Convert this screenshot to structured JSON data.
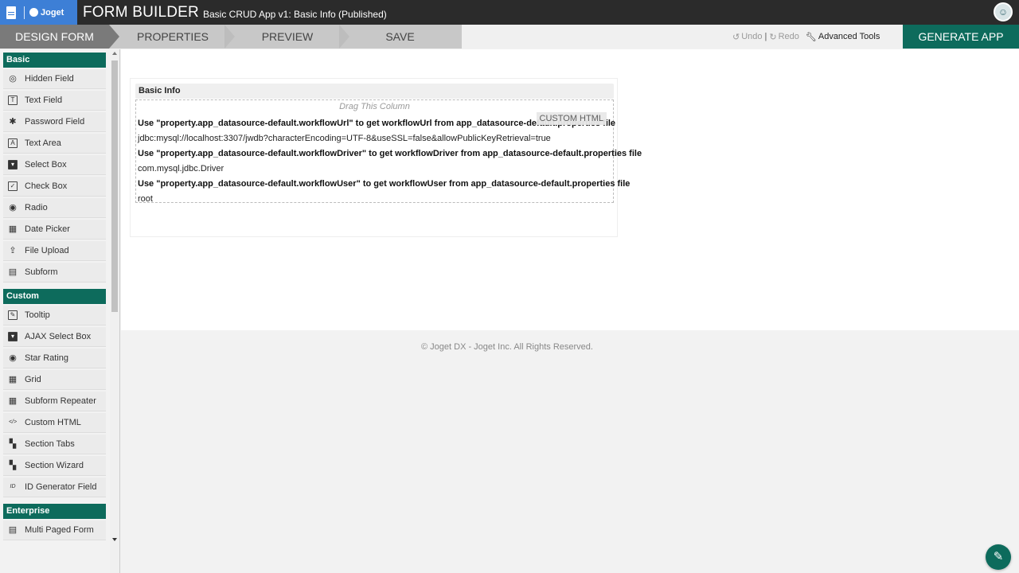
{
  "topbar": {
    "logo_text": "Joget",
    "title": "FORM BUILDER",
    "subtitle": "Basic CRUD App v1: Basic Info (Published)"
  },
  "steps": [
    {
      "label": "DESIGN FORM"
    },
    {
      "label": "PROPERTIES"
    },
    {
      "label": "PREVIEW"
    },
    {
      "label": "SAVE"
    }
  ],
  "toolbar": {
    "undo_label": "Undo",
    "sep": "|",
    "redo_label": "Redo",
    "advanced_label": "Advanced Tools",
    "generate_label": "GENERATE APP"
  },
  "palette": {
    "basic_heading": "Basic",
    "basic_items": [
      {
        "label": "Hidden Field",
        "icon": "eye-slash-icon"
      },
      {
        "label": "Text Field",
        "icon": "text-field-icon"
      },
      {
        "label": "Password Field",
        "icon": "asterisk-icon"
      },
      {
        "label": "Text Area",
        "icon": "text-area-icon"
      },
      {
        "label": "Select Box",
        "icon": "select-box-icon"
      },
      {
        "label": "Check Box",
        "icon": "check-box-icon"
      },
      {
        "label": "Radio",
        "icon": "radio-icon"
      },
      {
        "label": "Date Picker",
        "icon": "calendar-icon"
      },
      {
        "label": "File Upload",
        "icon": "upload-icon"
      },
      {
        "label": "Subform",
        "icon": "subform-icon"
      }
    ],
    "custom_heading": "Custom",
    "custom_items": [
      {
        "label": "Tooltip",
        "icon": "edit-icon"
      },
      {
        "label": "AJAX Select Box",
        "icon": "select-box-icon"
      },
      {
        "label": "Star Rating",
        "icon": "radio-icon"
      },
      {
        "label": "Grid",
        "icon": "grid-icon"
      },
      {
        "label": "Subform Repeater",
        "icon": "grid-icon"
      },
      {
        "label": "Custom HTML",
        "icon": "code-icon"
      },
      {
        "label": "Section Tabs",
        "icon": "section-icon"
      },
      {
        "label": "Section Wizard",
        "icon": "section-icon"
      },
      {
        "label": "ID Generator Field",
        "icon": "id-icon"
      }
    ],
    "enterprise_heading": "Enterprise",
    "enterprise_items": [
      {
        "label": "Multi Paged Form",
        "icon": "pages-icon"
      }
    ]
  },
  "form": {
    "section_title": "Basic Info",
    "drag_column": "Drag This Column",
    "badge": "CUSTOM HTML",
    "lines": [
      "Use \"property.app_datasource-default.workflowUrl\" to get workflowUrl from app_datasource-default.properties file",
      "jdbc:mysql://localhost:3307/jwdb?characterEncoding=UTF-8&useSSL=false&allowPublicKeyRetrieval=true",
      "Use \"property.app_datasource-default.workflowDriver\" to get workflowDriver from app_datasource-default.properties file",
      "com.mysql.jdbc.Driver",
      "Use \"property.app_datasource-default.workflowUser\" to get workflowUser from app_datasource-default.properties file",
      "root"
    ]
  },
  "footer": {
    "copyright": "© Joget DX - Joget Inc. All Rights Reserved."
  }
}
